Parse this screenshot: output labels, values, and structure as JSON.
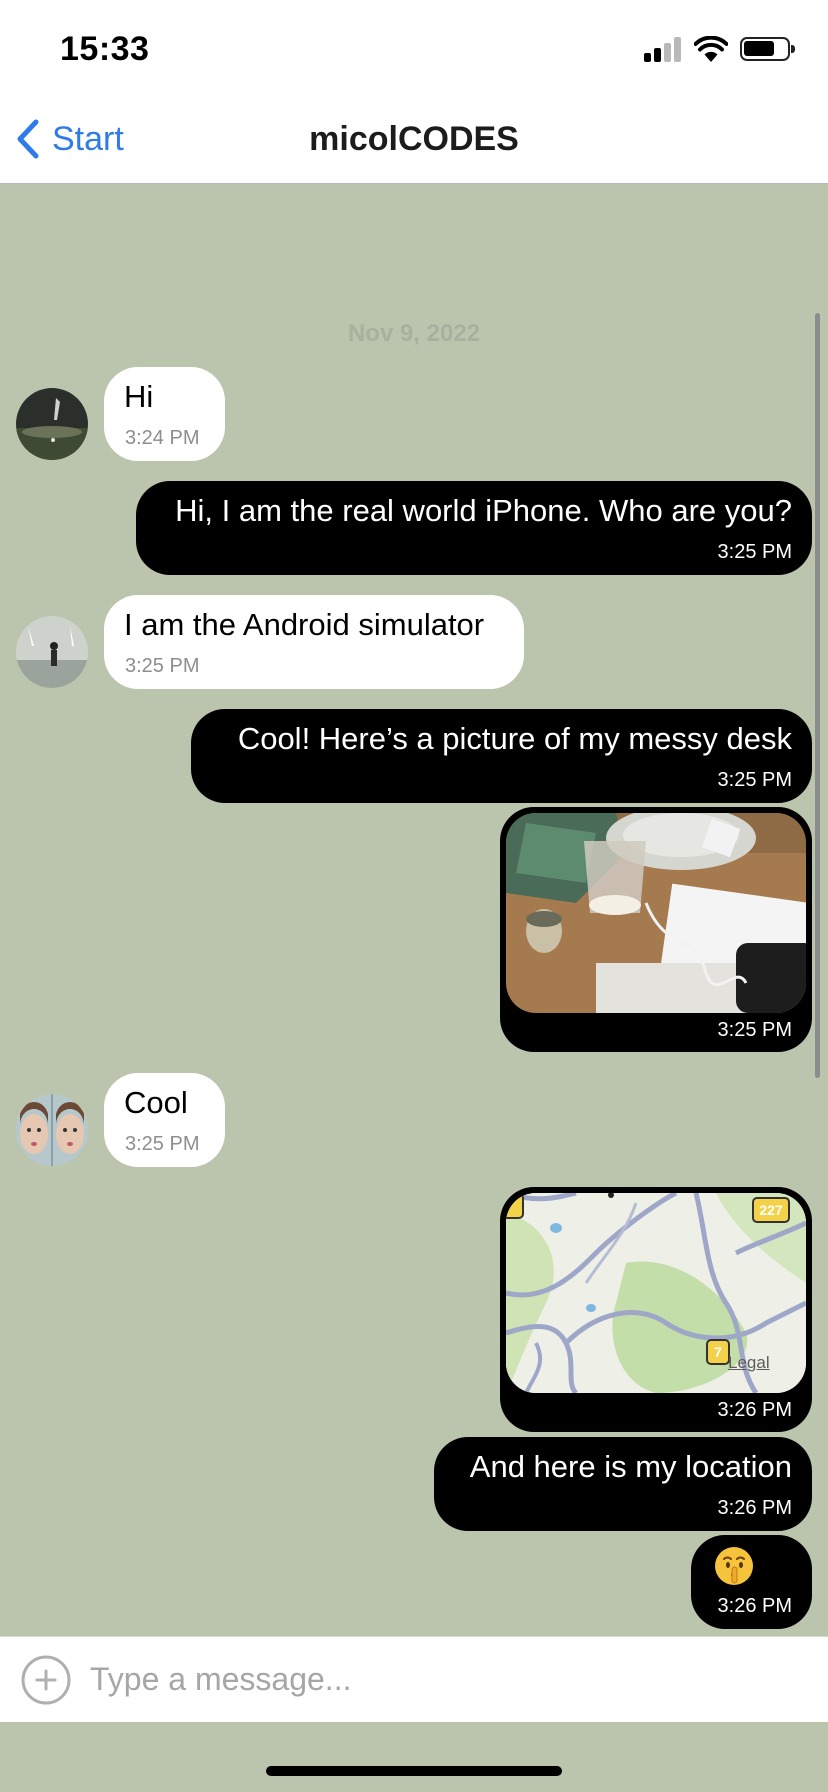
{
  "status_bar": {
    "time": "15:33",
    "battery": 0.7
  },
  "nav": {
    "back_label": "Start",
    "title": "micolCODES"
  },
  "chat": {
    "date_label": "Nov 9, 2022",
    "messages": [
      {
        "direction": "incoming",
        "text": "Hi",
        "time": "3:24 PM"
      },
      {
        "direction": "outgoing",
        "text": "Hi, I am the real world iPhone. Who are you?",
        "time": "3:25 PM"
      },
      {
        "direction": "incoming",
        "text": "I am the Android simulator",
        "time": "3:25 PM"
      },
      {
        "direction": "outgoing",
        "text": "Cool! Here’s a picture of my messy desk",
        "time": "3:25 PM"
      },
      {
        "direction": "outgoing",
        "type": "image",
        "time": "3:25 PM"
      },
      {
        "direction": "incoming",
        "text": "Cool",
        "time": "3:25 PM"
      },
      {
        "direction": "outgoing",
        "type": "location",
        "time": "3:26 PM",
        "map": {
          "badge_top": "227",
          "badge_bottom": "7",
          "legal": "Legal"
        }
      },
      {
        "direction": "outgoing",
        "text": "And here is my location",
        "time": "3:26 PM"
      },
      {
        "direction": "outgoing",
        "text": "🤫",
        "time": "3:26 PM"
      }
    ]
  },
  "input": {
    "placeholder": "Type a message..."
  },
  "colors": {
    "chat_background": "#bbc5ae",
    "outgoing_bubble": "#000000",
    "incoming_bubble": "#ffffff",
    "accent": "#2f7bea"
  }
}
